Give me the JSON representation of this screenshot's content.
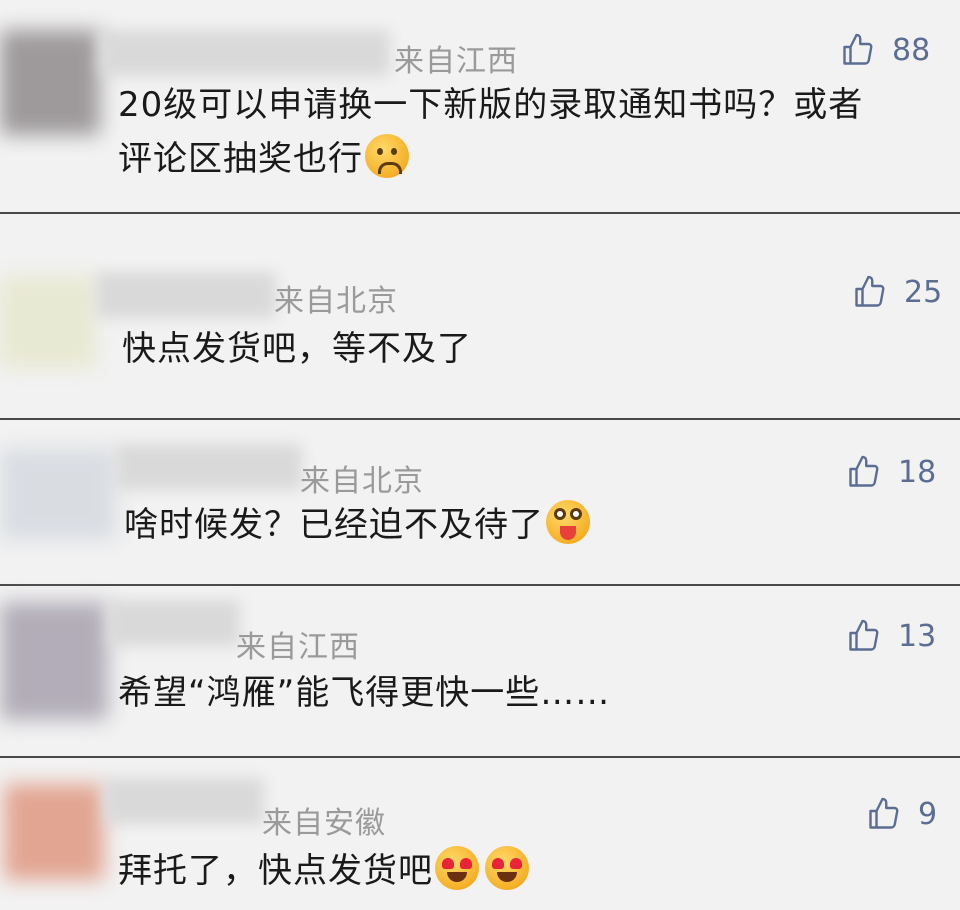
{
  "comments": [
    {
      "location": "来自江西",
      "likes": "88",
      "text1": "20级可以申请换一下新版的录取通知书吗？或者",
      "text2": "评论区抽奖也行",
      "emoji": "sad-emoji"
    },
    {
      "location": "来自北京",
      "likes": "25",
      "text1": "快点发货吧，等不及了"
    },
    {
      "location": "来自北京",
      "likes": "18",
      "text1": "啥时候发？已经迫不及待了",
      "emoji": "tongue-emoji"
    },
    {
      "location": "来自江西",
      "likes": "13",
      "text1": "希望“鸿雁”能飞得更快一些……"
    },
    {
      "location": "来自安徽",
      "likes": "9",
      "text1": "拜托了，快点发货吧",
      "emoji": "heart-eyes-emoji"
    }
  ],
  "colors": {
    "background": "#f2f2f2",
    "like": "#5b6d92",
    "location": "#9a9a9a",
    "divider": "#4a4a4a"
  }
}
